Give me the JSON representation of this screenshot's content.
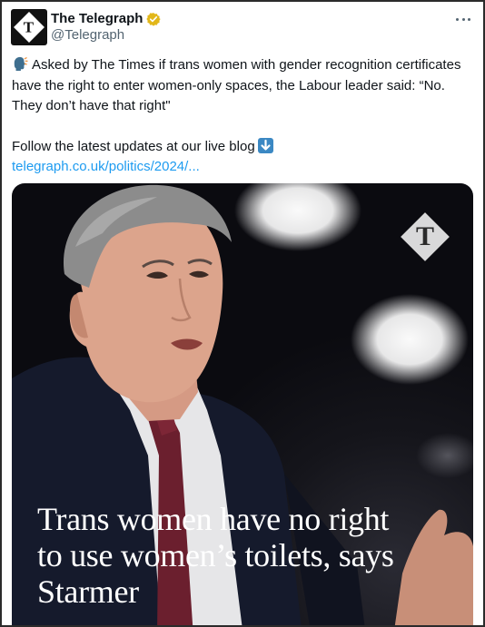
{
  "account": {
    "display_name": "The Telegraph",
    "handle": "@Telegraph",
    "avatar_letter": "T"
  },
  "tweet": {
    "text_line1": "Asked by The Times if trans women with gender recognition certificates have the right to enter women-only spaces, the Labour leader said: “No. They don’t have that right\"",
    "text_line2": "Follow the latest updates at our live blog",
    "link": "telegraph.co.uk/politics/2024/..."
  },
  "media": {
    "logo_letter": "T",
    "headline": "Trans women have no right to use women’s toilets, says Starmer"
  },
  "icons": {
    "verified": "verified-badge-icon",
    "more": "more-options-icon",
    "speaking_head": "speaking-head-icon",
    "down_arrow": "down-arrow-icon"
  },
  "colors": {
    "link": "#1d9bf0",
    "verified": "#e2b719",
    "secondary_text": "#536471"
  }
}
